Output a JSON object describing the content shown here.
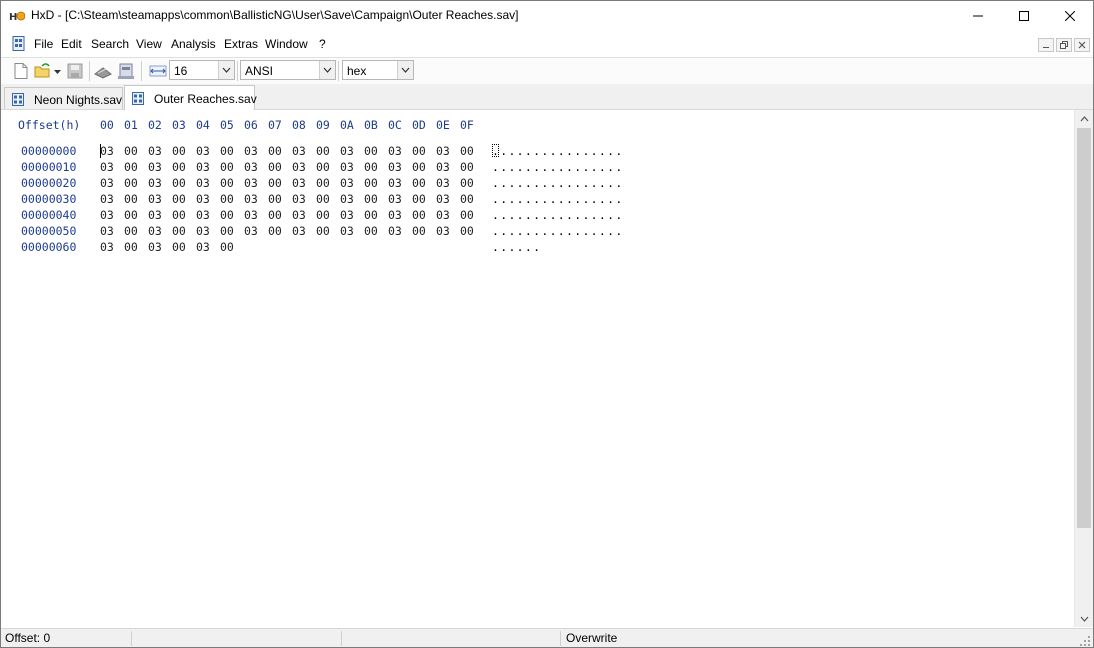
{
  "window": {
    "title": "HxD - [C:\\Steam\\steamapps\\common\\BallisticNG\\User\\Save\\Campaign\\Outer Reaches.sav]"
  },
  "menu": {
    "items": [
      "File",
      "Edit",
      "Search",
      "View",
      "Analysis",
      "Extras",
      "Window",
      "?"
    ]
  },
  "toolbar": {
    "bytes_per_row": "16",
    "charset": "ANSI",
    "offset_base": "hex"
  },
  "tabs": [
    {
      "label": "Neon Nights.sav",
      "active": false
    },
    {
      "label": "Outer Reaches.sav",
      "active": true
    }
  ],
  "hex": {
    "offset_header": "Offset(h)",
    "columns": [
      "00",
      "01",
      "02",
      "03",
      "04",
      "05",
      "06",
      "07",
      "08",
      "09",
      "0A",
      "0B",
      "0C",
      "0D",
      "0E",
      "0F"
    ],
    "rows": [
      {
        "offset": "00000000",
        "bytes": [
          "03",
          "00",
          "03",
          "00",
          "03",
          "00",
          "03",
          "00",
          "03",
          "00",
          "03",
          "00",
          "03",
          "00",
          "03",
          "00"
        ],
        "ascii": "................"
      },
      {
        "offset": "00000010",
        "bytes": [
          "03",
          "00",
          "03",
          "00",
          "03",
          "00",
          "03",
          "00",
          "03",
          "00",
          "03",
          "00",
          "03",
          "00",
          "03",
          "00"
        ],
        "ascii": "................"
      },
      {
        "offset": "00000020",
        "bytes": [
          "03",
          "00",
          "03",
          "00",
          "03",
          "00",
          "03",
          "00",
          "03",
          "00",
          "03",
          "00",
          "03",
          "00",
          "03",
          "00"
        ],
        "ascii": "................"
      },
      {
        "offset": "00000030",
        "bytes": [
          "03",
          "00",
          "03",
          "00",
          "03",
          "00",
          "03",
          "00",
          "03",
          "00",
          "03",
          "00",
          "03",
          "00",
          "03",
          "00"
        ],
        "ascii": "................"
      },
      {
        "offset": "00000040",
        "bytes": [
          "03",
          "00",
          "03",
          "00",
          "03",
          "00",
          "03",
          "00",
          "03",
          "00",
          "03",
          "00",
          "03",
          "00",
          "03",
          "00"
        ],
        "ascii": "................"
      },
      {
        "offset": "00000050",
        "bytes": [
          "03",
          "00",
          "03",
          "00",
          "03",
          "00",
          "03",
          "00",
          "03",
          "00",
          "03",
          "00",
          "03",
          "00",
          "03",
          "00"
        ],
        "ascii": "................"
      },
      {
        "offset": "00000060",
        "bytes": [
          "03",
          "00",
          "03",
          "00",
          "03",
          "00"
        ],
        "ascii": "......"
      }
    ]
  },
  "status": {
    "offset": "Offset: 0",
    "mode": "Overwrite"
  }
}
